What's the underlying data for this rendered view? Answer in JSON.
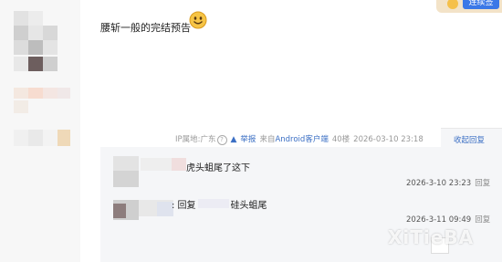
{
  "post": {
    "text": "腰斩一般的完结预告"
  },
  "header": {
    "badge_label": "连续签"
  },
  "meta": {
    "ip_label": "IP属地:广东",
    "report_label": "举报",
    "source_prefix": "来自",
    "client_label": "Android客户端",
    "floor": "40楼",
    "timestamp": "2026-03-10 23:18",
    "collapse_label": "收起回复"
  },
  "replies": [
    {
      "text": "虎头蛆尾了这下",
      "time": "2026-3-10 23:23",
      "reply_label": "回复"
    },
    {
      "text_prefix": ": 回复",
      "text_suffix": "硅头蛆尾",
      "time": "2026-3-11 09:49",
      "reply_label": "回复"
    }
  ],
  "watermark": "XiTieBA"
}
